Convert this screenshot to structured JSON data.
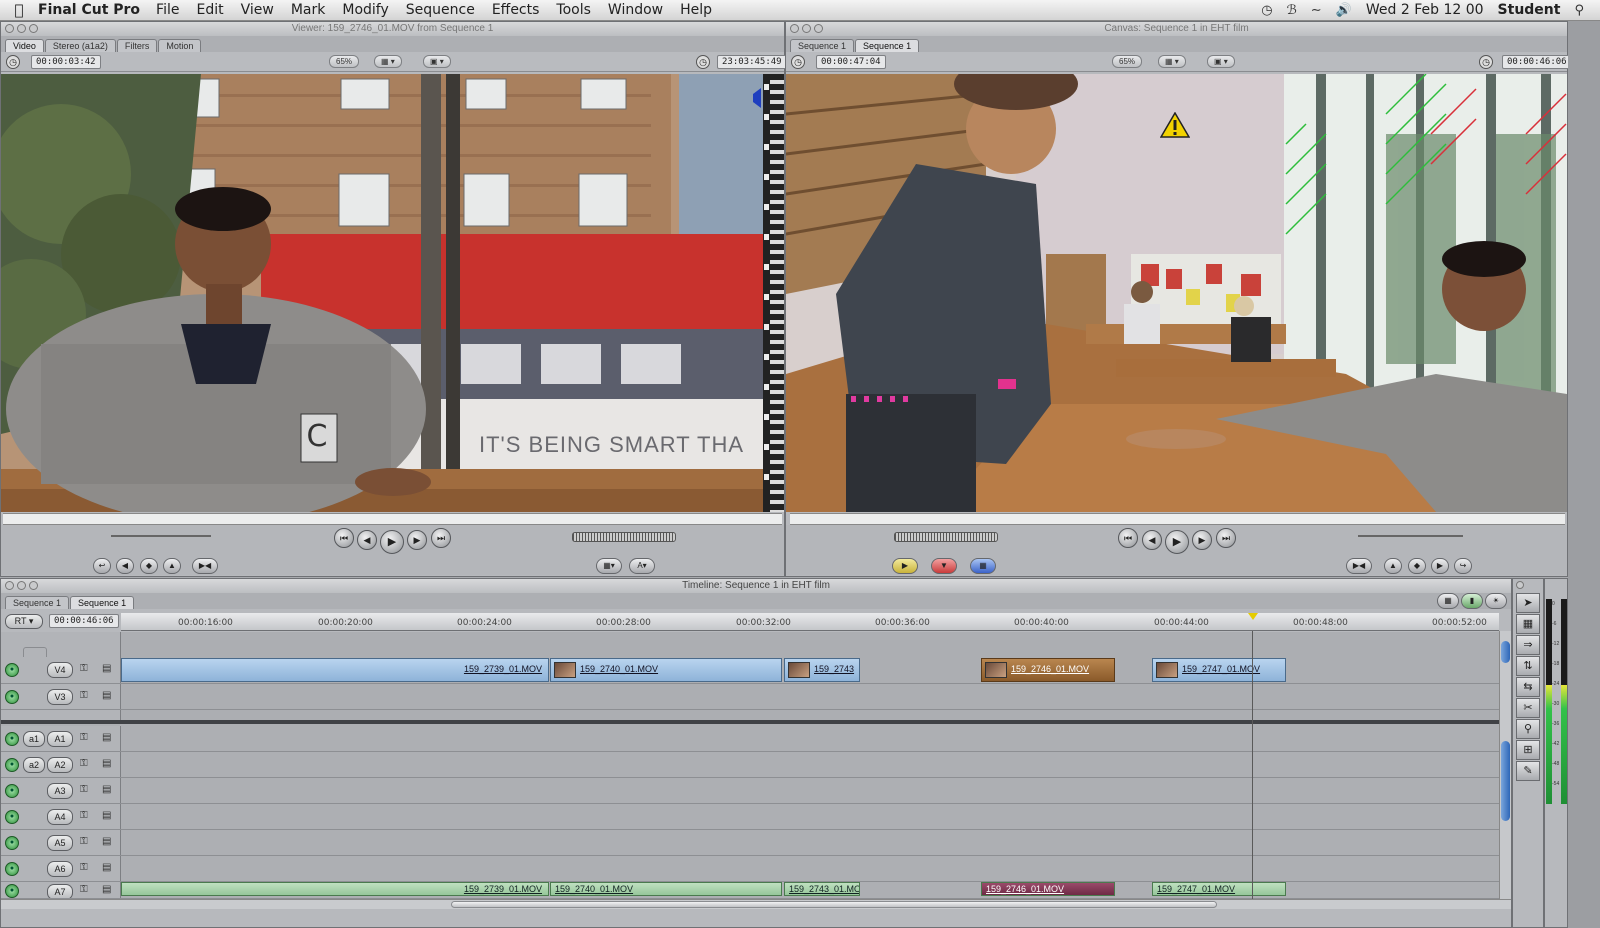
{
  "menubar": {
    "app_name": "Final Cut Pro",
    "items": [
      "File",
      "Edit",
      "View",
      "Mark",
      "Modify",
      "Sequence",
      "Effects",
      "Tools",
      "Window",
      "Help"
    ],
    "clock": "Wed 2 Feb  12 00",
    "user": "Student"
  },
  "viewer": {
    "title": "Viewer: 159_2746_01.MOV from Sequence 1",
    "tabs": [
      "Video",
      "Stereo (a1a2)",
      "Filters",
      "Motion"
    ],
    "duration_tc": "00:00:03:42",
    "zoom": "65%",
    "current_tc": "23:03:45:49",
    "bus_text": "IT'S BEING SMART THA"
  },
  "canvas": {
    "title": "Canvas: Sequence 1 in EHT film",
    "tabs": [
      "Sequence 1",
      "Sequence 1"
    ],
    "duration_tc": "00:00:47:04",
    "zoom": "65%",
    "current_tc": "00:00:46:06"
  },
  "timeline": {
    "title": "Timeline: Sequence 1 in EHT film",
    "tabs": [
      "Sequence 1",
      "Sequence 1"
    ],
    "rt_label": "RT",
    "current_tc": "00:00:46:06",
    "ruler_ticks": [
      "00:00:16:00",
      "00:00:20:00",
      "00:00:24:00",
      "00:00:28:00",
      "00:00:32:00",
      "00:00:36:00",
      "00:00:40:00",
      "00:00:44:00",
      "00:00:48:00",
      "00:00:52:00"
    ],
    "video_tracks": [
      {
        "label": "V4",
        "clips": [
          {
            "name": "159_2739_01.MOV",
            "selected": false,
            "thumb": false
          },
          {
            "name": "159_2740_01.MOV",
            "selected": false,
            "thumb": true
          },
          {
            "name": "159_2743",
            "selected": false,
            "thumb": true
          },
          {
            "name": "159_2746_01.MOV",
            "selected": true,
            "thumb": true
          },
          {
            "name": "159_2747_01.MOV",
            "selected": false,
            "thumb": true
          }
        ]
      },
      {
        "label": "V3",
        "clips": []
      }
    ],
    "audio_tracks": [
      {
        "src": "a1",
        "label": "A1"
      },
      {
        "src": "a2",
        "label": "A2"
      },
      {
        "src": "",
        "label": "A3"
      },
      {
        "src": "",
        "label": "A4"
      },
      {
        "src": "",
        "label": "A5"
      },
      {
        "src": "",
        "label": "A6"
      },
      {
        "src": "",
        "label": "A7"
      }
    ],
    "a7_clips": [
      "159_2739_01.MOV",
      "159_2740_01.MOV",
      "159_2743_01.MOV",
      "159_2746_01.MOV",
      "159_2747_01.MOV"
    ],
    "playhead_time": "00:00:46:06"
  },
  "meters": {
    "scale": [
      "0",
      "-6",
      "-12",
      "-18",
      "-24",
      "-30",
      "-36",
      "-42",
      "-48",
      "-54"
    ],
    "level_fraction": 0.58
  },
  "colors": {
    "video_clip": "#a9c8e8",
    "selected_clip": "#a8723e",
    "audio_clip": "#b4d9b6",
    "warning": "#f2d200"
  },
  "icons": {
    "warning": "warning-triangle-icon",
    "spotlight": "search-icon",
    "apple": "apple-icon"
  }
}
